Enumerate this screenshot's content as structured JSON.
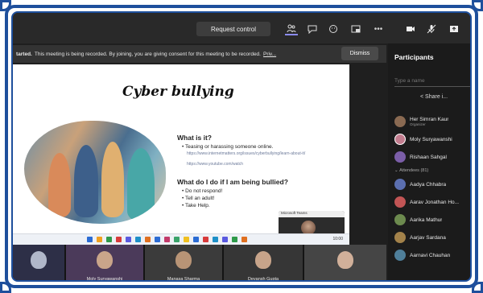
{
  "toolbar": {
    "request_control": "Request control",
    "icons": [
      "people-icon",
      "chat-icon",
      "reactions-icon",
      "rooms-icon",
      "more-icon",
      "camera-icon",
      "mic-icon",
      "share-icon"
    ]
  },
  "banner": {
    "bold": "tarted.",
    "text": "This meeting is being recorded. By joining, you are giving consent for this meeting to be recorded.",
    "privacy": "Priv...",
    "dismiss": "Dismiss"
  },
  "slide": {
    "title": "Cyber bullying",
    "section1": {
      "heading": "What is it?",
      "bullets": [
        "Teasing or harassing someone online."
      ],
      "links": [
        "https://www.internetmatters.org/issues/cyberbullying/learn-about-it/",
        "https://www.youtube.com/watch"
      ]
    },
    "section2": {
      "heading": "What do I do if I am being bullied?",
      "bullets": [
        "Do not respond!",
        "Tell an adult!",
        "Take Help."
      ]
    },
    "mini_window_title": "Microsoft Teams"
  },
  "panel": {
    "title": "Participants",
    "search_placeholder": "Type a name",
    "share": "Share i...",
    "participants": [
      {
        "name": "Her Simran Kaur",
        "sub": "Organizer",
        "color": "#8a6a52"
      },
      {
        "name": "Moly Suryawanshi",
        "sub": "",
        "color": "#c27c8e"
      },
      {
        "name": "Rishaan Sahgal",
        "sub": "",
        "color": "#7b5ea8"
      }
    ],
    "attendees_label": "Attendees (81)",
    "attendees": [
      {
        "name": "Aadya Chhabra",
        "color": "#5b6fb0"
      },
      {
        "name": "Aarav Jonathan Ho...",
        "color": "#c25555"
      },
      {
        "name": "Aarika Mathur",
        "color": "#6c8a4e"
      },
      {
        "name": "Aarjav Sardana",
        "color": "#a3824a"
      },
      {
        "name": "Aarnavi Chauhan",
        "color": "#4f7f9a"
      }
    ]
  },
  "strip": {
    "tiles": [
      {
        "name": "",
        "bg": "#2d2f47",
        "face": "#b0b7c9"
      },
      {
        "name": "Moly Suryawanshi",
        "bg": "#4b3a5a",
        "face": "#c9a58a"
      },
      {
        "name": "Manasa Sharma",
        "bg": "#3b3b3b",
        "face": "#b89476"
      },
      {
        "name": "Devansh Gupta",
        "bg": "#363636",
        "face": "#c7a48a"
      },
      {
        "name": "",
        "bg": "#454545",
        "face": "#d1b09a"
      }
    ]
  },
  "taskbar": {
    "clock": "10:00"
  }
}
